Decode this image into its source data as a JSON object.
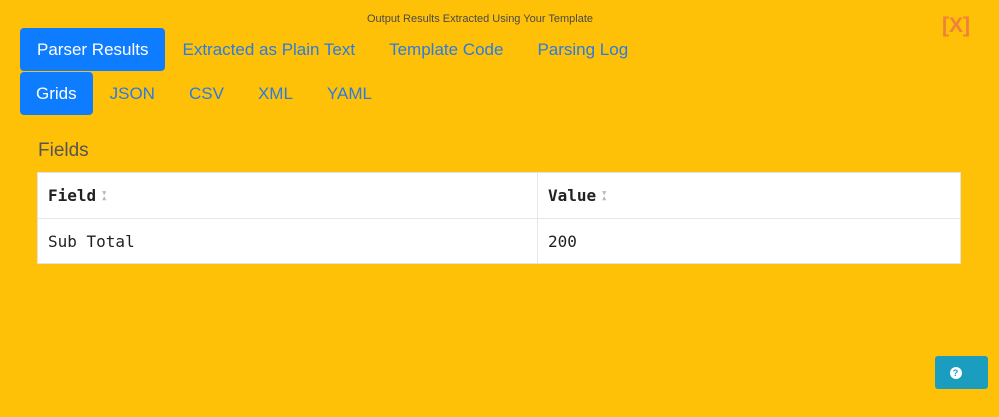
{
  "header": {
    "title": "Output Results Extracted Using Your Template",
    "close_label": "[X]"
  },
  "primary_tabs": [
    {
      "label": "Parser Results",
      "active": true
    },
    {
      "label": "Extracted as Plain Text",
      "active": false
    },
    {
      "label": "Template Code",
      "active": false
    },
    {
      "label": "Parsing Log",
      "active": false
    }
  ],
  "secondary_tabs": [
    {
      "label": "Grids",
      "active": true
    },
    {
      "label": "JSON",
      "active": false
    },
    {
      "label": "CSV",
      "active": false
    },
    {
      "label": "XML",
      "active": false
    },
    {
      "label": "YAML",
      "active": false
    }
  ],
  "fields_section": {
    "title": "Fields",
    "columns": [
      "Field",
      "Value"
    ],
    "rows": [
      [
        "Sub Total",
        "200"
      ]
    ]
  },
  "help_button": {
    "icon": "question-circle-icon"
  },
  "colors": {
    "background": "#FFC107",
    "accent": "#0d7cff",
    "help": "#1a9dbf",
    "close": "#f0803a"
  }
}
